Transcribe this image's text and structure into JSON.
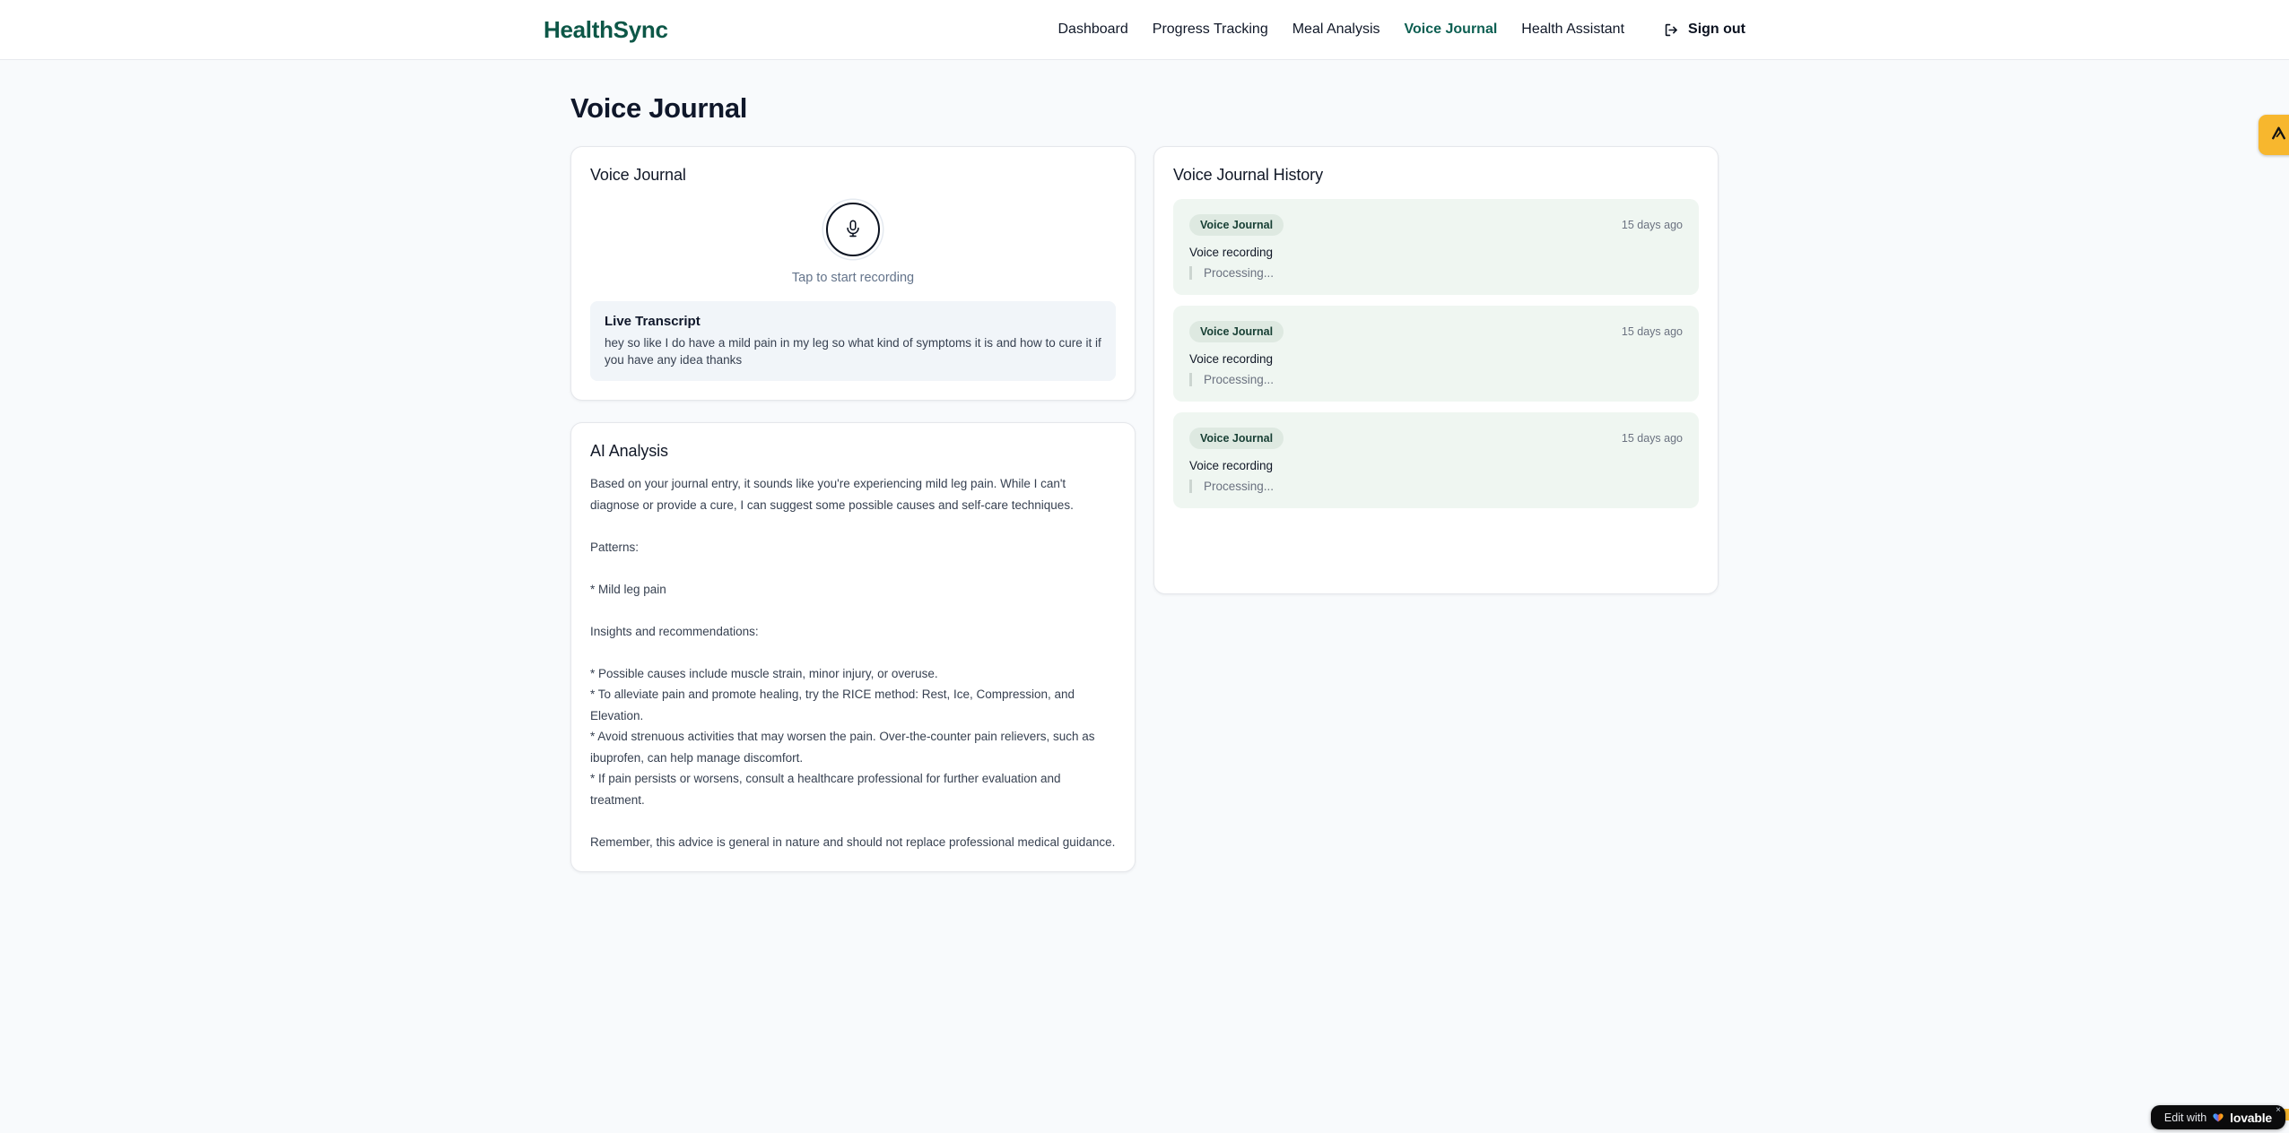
{
  "brand": {
    "name": "HealthSync"
  },
  "nav": {
    "items": [
      "Dashboard",
      "Progress Tracking",
      "Meal Analysis",
      "Voice Journal",
      "Health Assistant"
    ],
    "active_item": "Voice Journal",
    "sign_out_label": "Sign out"
  },
  "page": {
    "title": "Voice Journal"
  },
  "recorder": {
    "title": "Voice Journal",
    "tap_hint": "Tap to start recording",
    "transcript_title": "Live Transcript",
    "transcript_text": "hey so like I do have a mild pain in my leg so what kind of symptoms it is and how to cure it if you have any idea thanks"
  },
  "analysis": {
    "title": "AI Analysis",
    "body": "Based on your journal entry, it sounds like you're experiencing mild leg pain. While I can't diagnose or provide a cure, I can suggest some possible causes and self-care techniques.\n\nPatterns:\n\n* Mild leg pain\n\nInsights and recommendations:\n\n* Possible causes include muscle strain, minor injury, or overuse.\n* To alleviate pain and promote healing, try the RICE method: Rest, Ice, Compression, and Elevation.\n* Avoid strenuous activities that may worsen the pain. Over-the-counter pain relievers, such as ibuprofen, can help manage discomfort.\n* If pain persists or worsens, consult a healthcare professional for further evaluation and treatment.\n\nRemember, this advice is general in nature and should not replace professional medical guidance."
  },
  "history": {
    "title": "Voice Journal History",
    "entries": [
      {
        "badge": "Voice Journal",
        "time": "15 days ago",
        "label": "Voice recording",
        "status": "Processing..."
      },
      {
        "badge": "Voice Journal",
        "time": "15 days ago",
        "label": "Voice recording",
        "status": "Processing..."
      },
      {
        "badge": "Voice Journal",
        "time": "15 days ago",
        "label": "Voice recording",
        "status": "Processing..."
      }
    ]
  },
  "overlay": {
    "edit_prefix": "Edit with",
    "edit_brand": "lovable",
    "close_glyph": "×"
  },
  "colors": {
    "brand": "#0d5747",
    "nav-active": "#0d5f52",
    "side-badge": "#f7b72e",
    "lovable-bg": "#0b0b0c",
    "history-bg": "#eff6f1",
    "badge-bg": "#dee9e1",
    "badge-text": "#173f34",
    "page-bg": "#f8fafc"
  }
}
